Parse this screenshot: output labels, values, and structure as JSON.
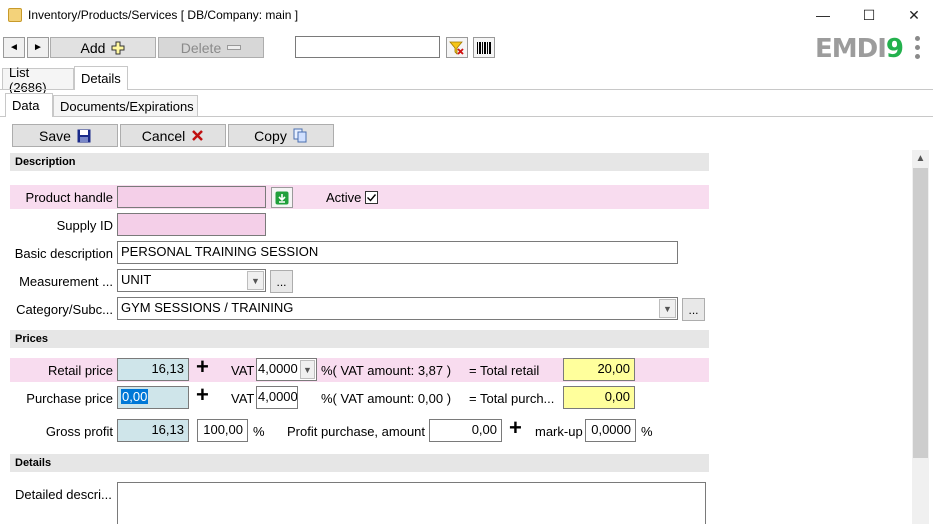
{
  "window": {
    "title": "Inventory/Products/Services   [ DB/Company: main ]",
    "minimize": "—",
    "maximize": "☐",
    "close": "✕"
  },
  "toolbar": {
    "prev": "◄",
    "next": "►",
    "add_label": "Add",
    "delete_label": "Delete",
    "search_value": ""
  },
  "logo": {
    "text": "EMDI",
    "nine": "9"
  },
  "tabs": {
    "list": "List (2686)",
    "details": "Details"
  },
  "subtabs": {
    "data": "Data",
    "documents": "Documents/Expirations"
  },
  "actions": {
    "save": "Save",
    "cancel": "Cancel",
    "copy": "Copy"
  },
  "description": {
    "section_title": "Description",
    "product_handle_label": "Product handle",
    "product_handle_value": "",
    "active_label": "Active",
    "active_checked": true,
    "supply_id_label": "Supply ID",
    "supply_id_value": "",
    "basic_description_label": "Basic description",
    "basic_description_value": "PERSONAL TRAINING SESSION",
    "measurement_label": "Measurement ...",
    "measurement_value": "UNIT",
    "category_label": "Category/Subc...",
    "category_value": "GYM SESSIONS / TRAINING",
    "dots": "..."
  },
  "prices": {
    "section_title": "Prices",
    "retail_price_label": "Retail price",
    "retail_price_value": "16,13",
    "vat_label": "VAT",
    "retail_vat_value": "4,0000",
    "retail_vat_amount": "%( VAT amount: 3,87 )",
    "total_retail_label": "= Total retail",
    "total_retail_value": "20,00",
    "purchase_price_label": "Purchase price",
    "purchase_price_value": "0,00",
    "purchase_vat_value": "4,0000",
    "purchase_vat_amount": "%( VAT amount: 0,00 )",
    "total_purchase_label": "= Total purch...",
    "total_purchase_value": "0,00",
    "gross_profit_label": "Gross profit",
    "gross_profit_value": "16,13",
    "gross_profit_percent": "100,00",
    "percent_sign": "%",
    "profit_purchase_label": "Profit purchase, amount",
    "profit_purchase_value": "0,00",
    "markup_label": "mark-up",
    "markup_value": "0,0000",
    "plus": "+"
  },
  "details": {
    "section_title": "Details",
    "detailed_description_label": "Detailed descri...",
    "detailed_description_value": ""
  },
  "colors": {
    "pink_row": "#f8dcef",
    "pink_field": "#f4cfe8",
    "blue_field": "#cfe5ea",
    "yellow_field": "#ffff9c",
    "logo_green": "#23b14d"
  }
}
